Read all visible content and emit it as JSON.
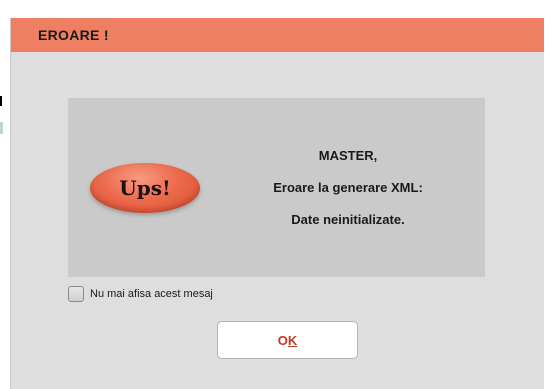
{
  "dialog": {
    "title": "EROARE !",
    "badge_text": "Ups!",
    "message_lines": [
      "MASTER,",
      "Eroare la generare XML:",
      "Date neinitializate."
    ],
    "checkbox": {
      "label": "Nu mai afisa acest mesaj",
      "checked": false
    },
    "ok_button": {
      "label_first": "O",
      "label_mnemonic": "K"
    }
  },
  "colors": {
    "title_bar": "#ee7f62",
    "dialog_bg": "#dedede",
    "panel_bg": "#cacaca",
    "badge": "#ec6a4c",
    "ok_text": "#c0392b"
  },
  "icons": {
    "badge": "ups-badge-icon"
  }
}
